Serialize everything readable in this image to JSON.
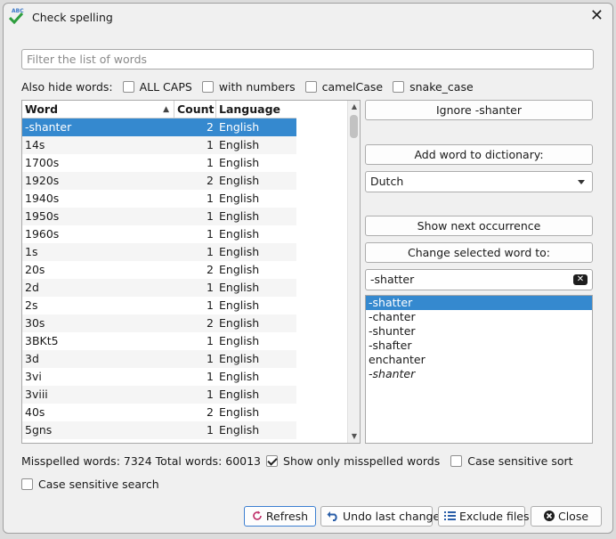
{
  "window": {
    "title": "Check spelling"
  },
  "filter": {
    "placeholder": "Filter the list of words",
    "value": ""
  },
  "hide_words": {
    "label": "Also hide words:",
    "options": [
      {
        "label": "ALL CAPS",
        "checked": false
      },
      {
        "label": "with numbers",
        "checked": false
      },
      {
        "label": "camelCase",
        "checked": false
      },
      {
        "label": "snake_case",
        "checked": false
      }
    ]
  },
  "table": {
    "headers": {
      "word": "Word",
      "count": "Count",
      "language": "Language"
    },
    "rows": [
      {
        "word": "-shanter",
        "count": "2",
        "language": "English",
        "selected": true
      },
      {
        "word": "14s",
        "count": "1",
        "language": "English"
      },
      {
        "word": "1700s",
        "count": "1",
        "language": "English"
      },
      {
        "word": "1920s",
        "count": "2",
        "language": "English"
      },
      {
        "word": "1940s",
        "count": "1",
        "language": "English"
      },
      {
        "word": "1950s",
        "count": "1",
        "language": "English"
      },
      {
        "word": "1960s",
        "count": "1",
        "language": "English"
      },
      {
        "word": "1s",
        "count": "1",
        "language": "English"
      },
      {
        "word": "20s",
        "count": "2",
        "language": "English"
      },
      {
        "word": "2d",
        "count": "1",
        "language": "English"
      },
      {
        "word": "2s",
        "count": "1",
        "language": "English"
      },
      {
        "word": "30s",
        "count": "2",
        "language": "English"
      },
      {
        "word": "3BKt5",
        "count": "1",
        "language": "English"
      },
      {
        "word": "3d",
        "count": "1",
        "language": "English"
      },
      {
        "word": "3vi",
        "count": "1",
        "language": "English"
      },
      {
        "word": "3viii",
        "count": "1",
        "language": "English"
      },
      {
        "word": "40s",
        "count": "2",
        "language": "English"
      },
      {
        "word": "5gns",
        "count": "1",
        "language": "English"
      }
    ]
  },
  "actions": {
    "ignore_label": "Ignore -shanter",
    "add_to_dict_label": "Add word to dictionary:",
    "dictionary_selected": "Dutch",
    "show_next_label": "Show next occurrence",
    "change_selected_label": "Change selected word to:",
    "replacement_value": "-shatter"
  },
  "suggestions": [
    {
      "text": "-shatter",
      "selected": true
    },
    {
      "text": "-chanter"
    },
    {
      "text": "-shunter"
    },
    {
      "text": "-shafter"
    },
    {
      "text": "enchanter"
    },
    {
      "text": "-shanter",
      "italic": true
    }
  ],
  "status": {
    "summary": "Misspelled words: 7324 Total words: 60013",
    "show_only_misspelled": {
      "label": "Show only misspelled words",
      "checked": true
    },
    "case_sensitive_sort": {
      "label": "Case sensitive sort",
      "checked": false
    },
    "case_sensitive_search": {
      "label": "Case sensitive search",
      "checked": false
    }
  },
  "footer": {
    "refresh": "Refresh",
    "undo": "Undo last change",
    "exclude": "Exclude files",
    "close": "Close"
  },
  "colors": {
    "selection": "#3589cf",
    "accent_check": "#2e9e3e"
  }
}
